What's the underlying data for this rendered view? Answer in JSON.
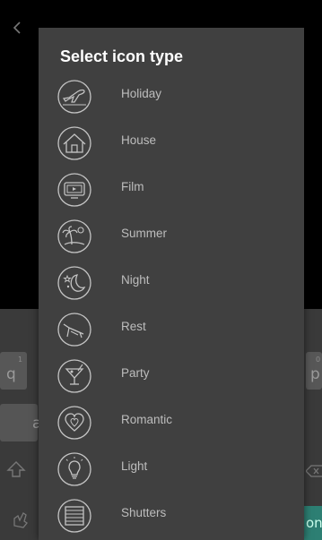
{
  "dialog": {
    "title": "Select icon type",
    "options": [
      {
        "label": "Holiday",
        "icon": "airplane-icon"
      },
      {
        "label": "House",
        "icon": "house-icon"
      },
      {
        "label": "Film",
        "icon": "film-icon"
      },
      {
        "label": "Summer",
        "icon": "summer-palm-icon"
      },
      {
        "label": "Night",
        "icon": "moon-stars-icon"
      },
      {
        "label": "Rest",
        "icon": "deck-chair-icon"
      },
      {
        "label": "Party",
        "icon": "cocktail-icon"
      },
      {
        "label": "Romantic",
        "icon": "heart-icon"
      },
      {
        "label": "Light",
        "icon": "light-bulb-icon"
      },
      {
        "label": "Shutters",
        "icon": "shutters-icon"
      }
    ]
  },
  "keyboard": {
    "left_keys": [
      "q",
      "a"
    ],
    "right_keys": [
      "p"
    ],
    "left_hint": "1",
    "right_hint": "0",
    "action_label": "on"
  },
  "colors": {
    "dialog_bg": "#404040",
    "title": "#ffffff",
    "label": "#bdbdbd",
    "icon": "#c4c4c4",
    "keyboard_bg": "#3a3a3a",
    "accent": "#2d7f73"
  }
}
